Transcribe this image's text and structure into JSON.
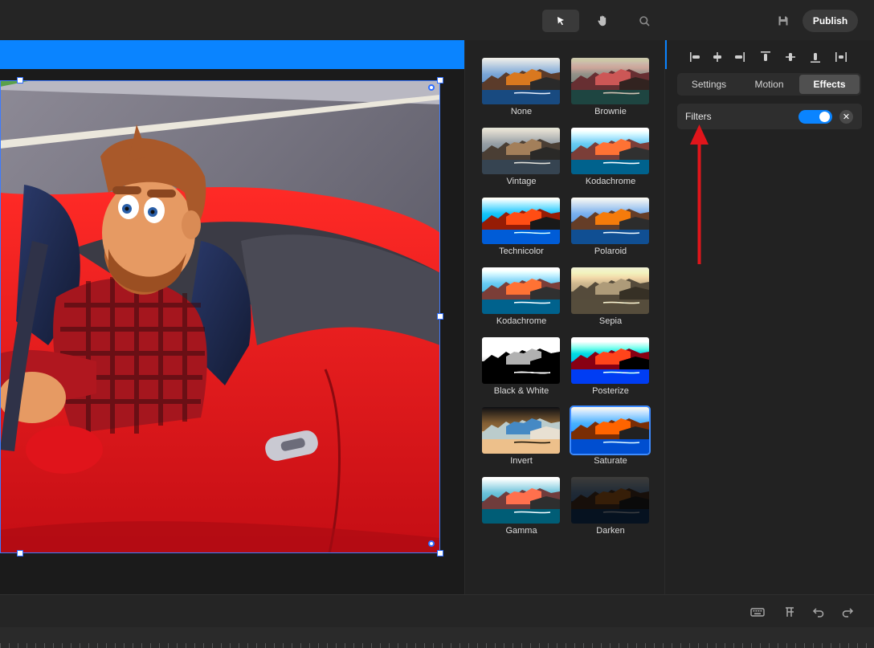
{
  "toolbar": {
    "tools": [
      {
        "name": "select",
        "icon": "cursor-icon",
        "active": true
      },
      {
        "name": "pan",
        "icon": "hand-icon",
        "active": false
      },
      {
        "name": "zoom",
        "icon": "search-icon",
        "active": false
      }
    ],
    "save_icon": "save-icon",
    "publish_label": "Publish"
  },
  "filters": [
    {
      "label": "None",
      "style": "none"
    },
    {
      "label": "Brownie",
      "style": "brownie"
    },
    {
      "label": "Vintage",
      "style": "vintage"
    },
    {
      "label": "Kodachrome",
      "style": "kodachrome"
    },
    {
      "label": "Technicolor",
      "style": "technicolor"
    },
    {
      "label": "Polaroid",
      "style": "polaroid"
    },
    {
      "label": "Kodachrome",
      "style": "kodachrome2"
    },
    {
      "label": "Sepia",
      "style": "sepia"
    },
    {
      "label": "Black & White",
      "style": "bw"
    },
    {
      "label": "Posterize",
      "style": "posterize"
    },
    {
      "label": "Invert",
      "style": "invert"
    },
    {
      "label": "Saturate",
      "style": "saturate",
      "selected": true
    },
    {
      "label": "Gamma",
      "style": "gamma"
    },
    {
      "label": "Darken",
      "style": "darken"
    }
  ],
  "properties": {
    "tabs": [
      {
        "label": "Settings",
        "active": false
      },
      {
        "label": "Motion",
        "active": false
      },
      {
        "label": "Effects",
        "active": true
      }
    ],
    "filters_row": {
      "label": "Filters",
      "enabled": true,
      "close_symbol": "✕"
    }
  },
  "colors": {
    "accent": "#0a84ff",
    "annotation_arrow": "#e0151b",
    "car_red": "#e3141b"
  }
}
